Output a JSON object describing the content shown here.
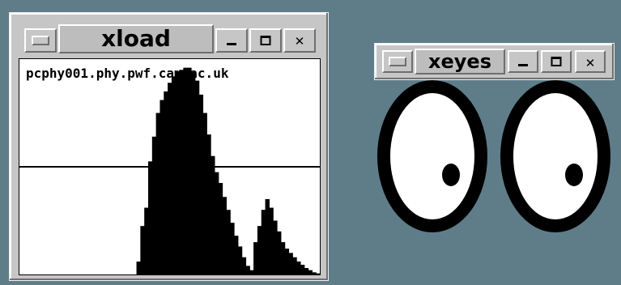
{
  "desktop": {
    "background": "#5f7c89"
  },
  "xload": {
    "title": "xload",
    "hostname": "pcphy001.phy.pwf.cam.ac.uk",
    "chart_data": {
      "type": "area",
      "title": "",
      "xlabel": "",
      "ylabel": "",
      "ylim": [
        0,
        2
      ],
      "reference_lines": [
        1
      ],
      "grid": false,
      "x": [
        0,
        29,
        30,
        31,
        32,
        33,
        34,
        35,
        36,
        37,
        38,
        39,
        40,
        41,
        42,
        43,
        44,
        45,
        46,
        47,
        48,
        49,
        50,
        51,
        52,
        53,
        54,
        55,
        56,
        57,
        58,
        59,
        60,
        61,
        62,
        63,
        64,
        65,
        66,
        67,
        68,
        69,
        70,
        71,
        72,
        73,
        74,
        75,
        76,
        77
      ],
      "values": [
        0,
        0,
        0.12,
        0.45,
        0.62,
        1.05,
        1.28,
        1.5,
        1.62,
        1.7,
        1.78,
        1.84,
        1.88,
        1.9,
        1.92,
        1.92,
        1.88,
        1.8,
        1.67,
        1.5,
        1.3,
        1.1,
        0.95,
        0.85,
        0.72,
        0.6,
        0.48,
        0.36,
        0.26,
        0.16,
        0.08,
        0.04,
        0.3,
        0.45,
        0.6,
        0.7,
        0.62,
        0.5,
        0.4,
        0.3,
        0.24,
        0.2,
        0.16,
        0.12,
        0.09,
        0.06,
        0.04,
        0.02,
        0.01,
        0
      ]
    }
  },
  "xeyes": {
    "title": "xeyes",
    "pupil_direction": "down-right"
  },
  "icons": {
    "window_menu": "window-menu-icon",
    "minimize": "minimize-icon",
    "maximize": "maximize-icon",
    "close": "close-icon",
    "close_glyph": "✕"
  },
  "colors": {
    "frame": "#c6c6c6",
    "title_pane": "#bdbdbd",
    "client": "#ffffff",
    "ink": "#000000"
  }
}
